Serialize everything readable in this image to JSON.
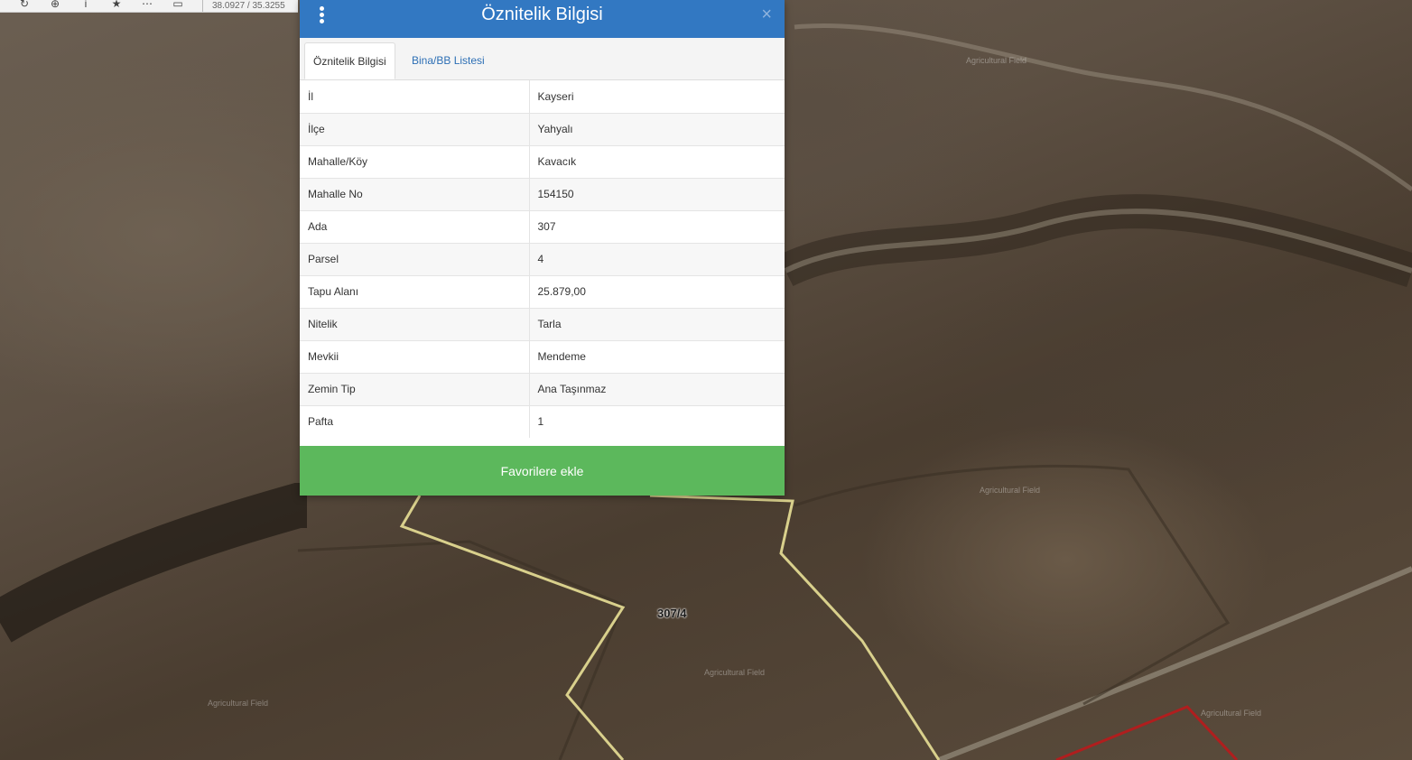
{
  "toolbar": {
    "coordinates": "38.0927 / 35.3255",
    "icons": [
      "refresh-icon",
      "location-icon",
      "info-icon",
      "star-icon",
      "measure-icon",
      "print-icon"
    ]
  },
  "map": {
    "parcel_label": "307/4",
    "ghost_labels": [
      "Agricultural Field",
      "Agricultural Field",
      "Agricultural Field",
      "Agricultural Field",
      "Agricultural Field"
    ],
    "parcel_outline_color": "#d9d08c",
    "neighbor_outline_color": "#b01e1e"
  },
  "panel": {
    "title": "Öznitelik Bilgisi",
    "close_glyph": "×",
    "header_color": "#3278c2",
    "tabs": [
      {
        "label": "Öznitelik Bilgisi",
        "active": true
      },
      {
        "label": "Bina/BB Listesi",
        "active": false
      }
    ],
    "attributes": [
      {
        "key": "İl",
        "value": "Kayseri"
      },
      {
        "key": "İlçe",
        "value": "Yahyalı"
      },
      {
        "key": "Mahalle/Köy",
        "value": "Kavacık"
      },
      {
        "key": "Mahalle No",
        "value": "154150"
      },
      {
        "key": "Ada",
        "value": "307"
      },
      {
        "key": "Parsel",
        "value": "4"
      },
      {
        "key": "Tapu Alanı",
        "value": "25.879,00"
      },
      {
        "key": "Nitelik",
        "value": "Tarla"
      },
      {
        "key": "Mevkii",
        "value": "Mendeme"
      },
      {
        "key": "Zemin Tip",
        "value": "Ana Taşınmaz"
      },
      {
        "key": "Pafta",
        "value": "1"
      }
    ],
    "favorite_button": "Favorilere ekle",
    "favorite_color": "#5cb85c"
  }
}
